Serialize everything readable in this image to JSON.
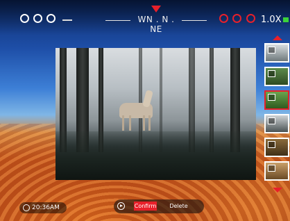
{
  "header": {
    "compass": "WN . N . NE",
    "zoom": "1.0X",
    "status_icons_left": [
      "wifi-icon",
      "disc-icon",
      "target-icon"
    ],
    "status_icons_right": [
      "photo-mode-icon",
      "record-icon",
      "gps-icon"
    ],
    "battery_color": "#3bd23b"
  },
  "colors": {
    "accent": "#e8202a",
    "text": "#ffffff"
  },
  "gallery": {
    "thumbnails": [
      {
        "type": "photo",
        "selected": false
      },
      {
        "type": "video",
        "selected": false
      },
      {
        "type": "photo",
        "selected": true
      },
      {
        "type": "photo",
        "selected": false
      },
      {
        "type": "photo",
        "selected": false
      },
      {
        "type": "video",
        "selected": false
      }
    ]
  },
  "footer": {
    "time": "20:36AM",
    "confirm_label": "Confirm",
    "delete_label": "Delete"
  }
}
